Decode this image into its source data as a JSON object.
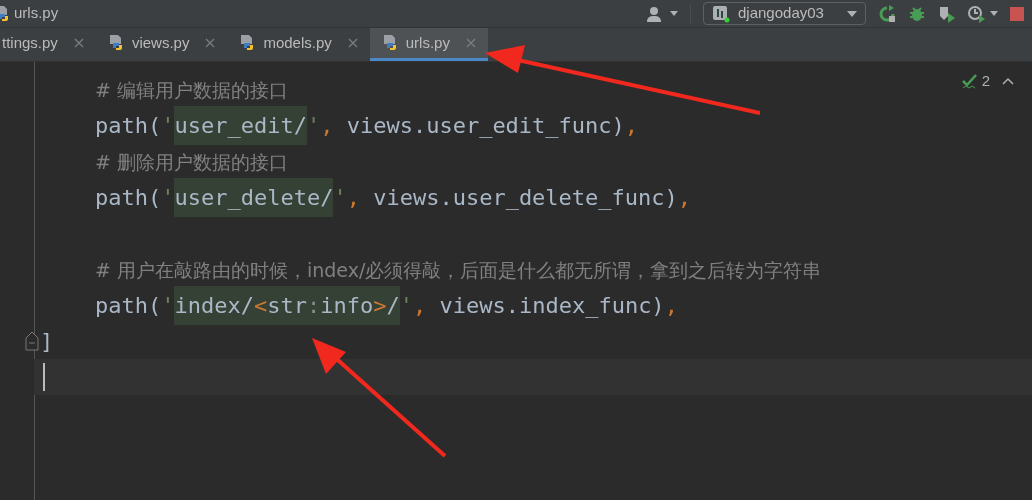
{
  "window": {
    "title": "urls.py"
  },
  "run_config": {
    "label": "djangoday03"
  },
  "tabs": [
    {
      "label": "ttings.py",
      "selected": false
    },
    {
      "label": "views.py",
      "selected": false
    },
    {
      "label": "models.py",
      "selected": false
    },
    {
      "label": "urls.py",
      "selected": true
    }
  ],
  "inspections": {
    "count": "2"
  },
  "code_lines": [
    {
      "tokens": [
        {
          "kind": "comment",
          "text": "# 编辑用户数据的接口"
        }
      ]
    },
    {
      "tokens": [
        {
          "kind": "code",
          "text": "path("
        },
        {
          "kind": "quote",
          "text": "'"
        },
        {
          "kind": "route",
          "text": "user_edit/"
        },
        {
          "kind": "quote",
          "text": "'"
        },
        {
          "kind": "comma",
          "text": ","
        },
        {
          "kind": "code",
          "text": " views.user_edit_func)"
        },
        {
          "kind": "comma",
          "text": ","
        }
      ]
    },
    {
      "tokens": [
        {
          "kind": "comment",
          "text": "# 删除用户数据的接口"
        }
      ]
    },
    {
      "tokens": [
        {
          "kind": "code",
          "text": "path("
        },
        {
          "kind": "quote",
          "text": "'"
        },
        {
          "kind": "route",
          "text": "user_delete/"
        },
        {
          "kind": "quote",
          "text": "'"
        },
        {
          "kind": "comma",
          "text": ","
        },
        {
          "kind": "code",
          "text": " views.user_delete_func)"
        },
        {
          "kind": "comma",
          "text": ","
        }
      ]
    },
    {
      "blank_line_before": true,
      "tokens": [
        {
          "kind": "comment",
          "text": "# 用户在敲路由的时候，index/必须得敲，后面是什么都无所谓，拿到之后转为字符串"
        }
      ]
    },
    {
      "tokens": [
        {
          "kind": "code",
          "text": "path("
        },
        {
          "kind": "quote",
          "text": "'"
        },
        {
          "kind": "route",
          "text": "index/"
        },
        {
          "kind": "route-tag",
          "text": "<"
        },
        {
          "kind": "route",
          "text": "str"
        },
        {
          "kind": "route-colon",
          "text": ":"
        },
        {
          "kind": "route",
          "text": "info"
        },
        {
          "kind": "route-tag",
          "text": ">"
        },
        {
          "kind": "route",
          "text": "/"
        },
        {
          "kind": "quote",
          "text": "'"
        },
        {
          "kind": "comma",
          "text": ","
        },
        {
          "kind": "code",
          "text": " views.index_func)"
        },
        {
          "kind": "comma",
          "text": ","
        }
      ]
    }
  ],
  "closing_line": {
    "text": "]"
  }
}
